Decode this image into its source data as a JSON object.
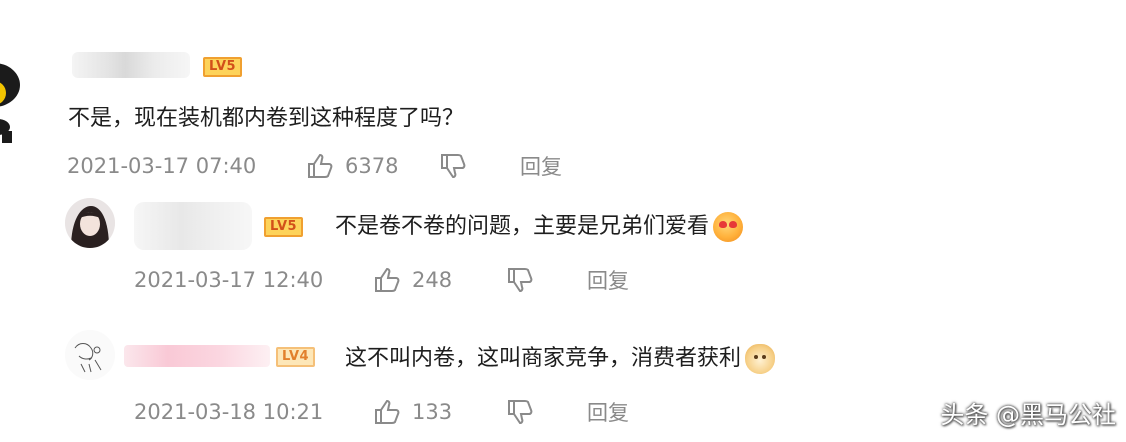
{
  "comments": [
    {
      "level": "LV5",
      "text": "不是，现在装机都内卷到这种程度了吗？",
      "time": "2021-03-17 07:40",
      "likes": "6378",
      "reply_label": "回复"
    },
    {
      "level": "LV5",
      "text": "不是卷不卷的问题，主要是兄弟们爱看",
      "emoji": "love-eyes-emoji",
      "time": "2021-03-17 12:40",
      "likes": "248",
      "reply_label": "回复"
    },
    {
      "level": "LV4",
      "text": "这不叫内卷，这叫商家竞争，消费者获利",
      "emoji": "doge-emoji",
      "time": "2021-03-18 10:21",
      "likes": "133",
      "reply_label": "回复"
    }
  ],
  "watermark": "头条 @黑马公社",
  "colors": {
    "meta_text": "#8a8a8a",
    "level_badge_bg": "#fdd35b",
    "level_badge_text": "#d2501a"
  }
}
